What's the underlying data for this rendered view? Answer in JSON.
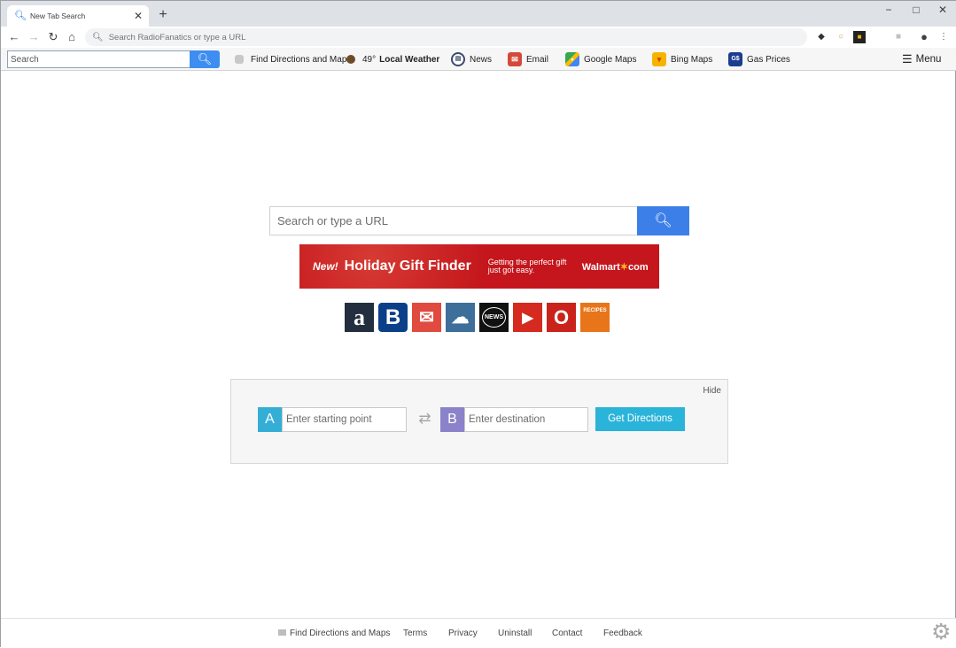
{
  "browser": {
    "tab_title": "New Tab Search",
    "tab_close": "✕",
    "new_tab": "+",
    "omnibox_placeholder": "Search RadioFanatics or type a URL"
  },
  "toolbar": {
    "search_placeholder": "Search",
    "links": [
      {
        "label": "Find Directions and Maps",
        "icon": "map-icon"
      },
      {
        "temp": "49°",
        "label": "Local Weather",
        "icon": "weather-icon"
      },
      {
        "label": "News",
        "icon": "news-icon"
      },
      {
        "label": "Email",
        "icon": "email-icon"
      },
      {
        "label": "Google Maps",
        "icon": "google-maps-icon"
      },
      {
        "label": "Bing Maps",
        "icon": "bing-maps-icon"
      },
      {
        "label": "Gas Prices",
        "icon": "gas-prices-icon"
      }
    ],
    "menu_label": "Menu"
  },
  "main": {
    "search_placeholder": "Search or type a URL",
    "banner": {
      "new": "New!",
      "title": "Holiday Gift Finder",
      "tagline": "Getting the perfect gift just got easy.",
      "brand": "Walmart",
      "brand_suffix": "com"
    },
    "quicklinks": [
      {
        "name": "amazon",
        "glyph": "a",
        "color": "#232f3e"
      },
      {
        "name": "booking",
        "glyph": "B",
        "color": "#0b3f8a"
      },
      {
        "name": "gmail",
        "glyph": "✉",
        "color": "#e04a3f"
      },
      {
        "name": "weather",
        "glyph": "☁",
        "color": "#3e6e9a"
      },
      {
        "name": "news",
        "glyph": "NEWS",
        "color": "#111111"
      },
      {
        "name": "youtube",
        "glyph": "▶",
        "color": "#d52a1f"
      },
      {
        "name": "overstock",
        "glyph": "O",
        "color": "#c9231b"
      },
      {
        "name": "recipes",
        "glyph": "RECIPES",
        "color": "#e8751a"
      }
    ]
  },
  "directions": {
    "hide_label": "Hide",
    "start_badge": "A",
    "start_placeholder": "Enter starting point",
    "end_badge": "B",
    "end_placeholder": "Enter destination",
    "button_label": "Get Directions",
    "colors": {
      "start": "#35aed6",
      "end": "#8b83c9"
    }
  },
  "footer": {
    "links": [
      "Find Directions and Maps",
      "Terms",
      "Privacy",
      "Uninstall",
      "Contact",
      "Feedback"
    ]
  }
}
